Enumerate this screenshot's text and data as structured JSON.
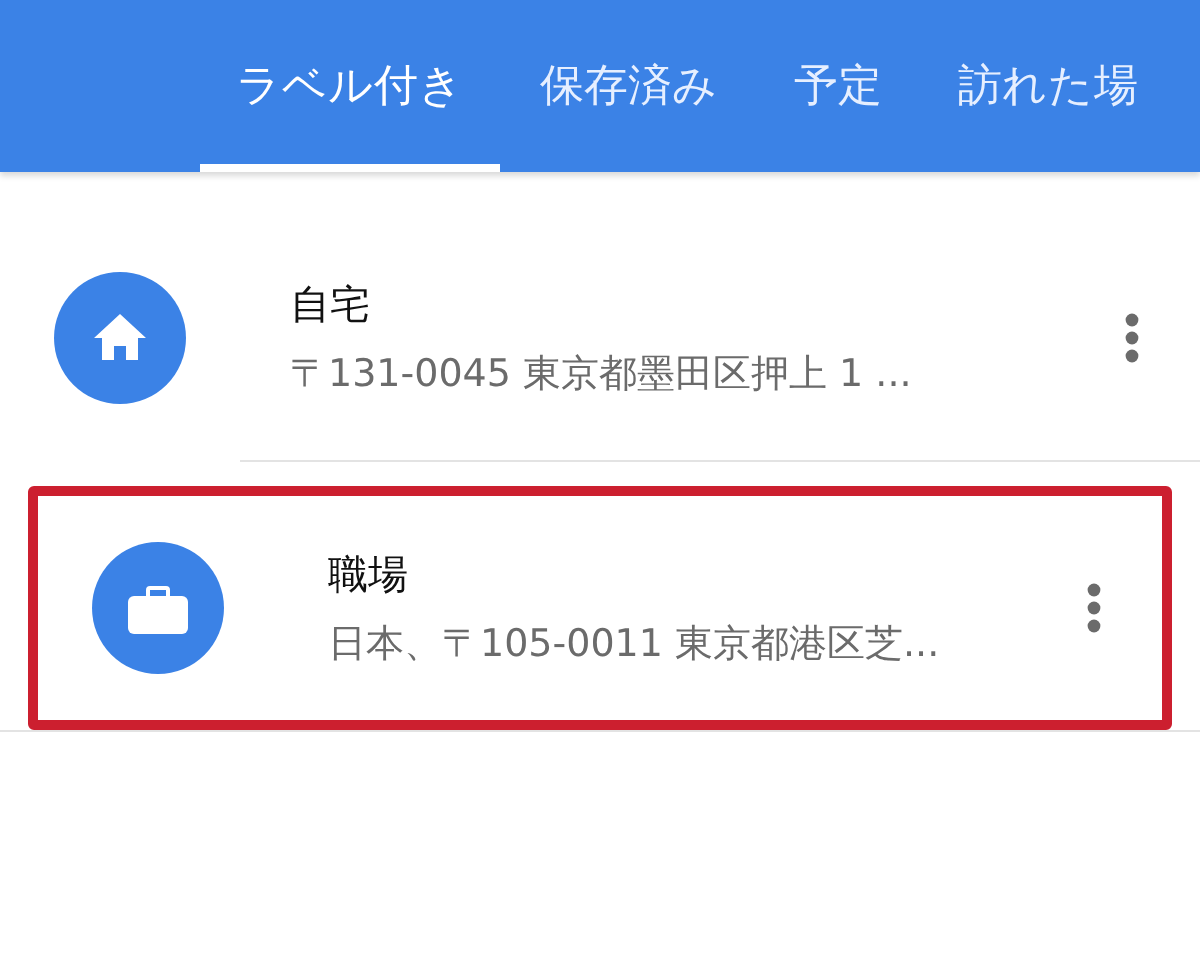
{
  "tabs": [
    {
      "label": "ラベル付き",
      "selected": true
    },
    {
      "label": "保存済み",
      "selected": false
    },
    {
      "label": "予定",
      "selected": false
    },
    {
      "label": "訪れた場",
      "selected": false
    }
  ],
  "places": [
    {
      "kind": "home",
      "title": "自宅",
      "address": "〒131-0045 東京都墨田区押上 1 ...",
      "highlighted": false
    },
    {
      "kind": "work",
      "title": "職場",
      "address": "日本、〒105-0011 東京都港区芝...",
      "highlighted": true
    }
  ]
}
